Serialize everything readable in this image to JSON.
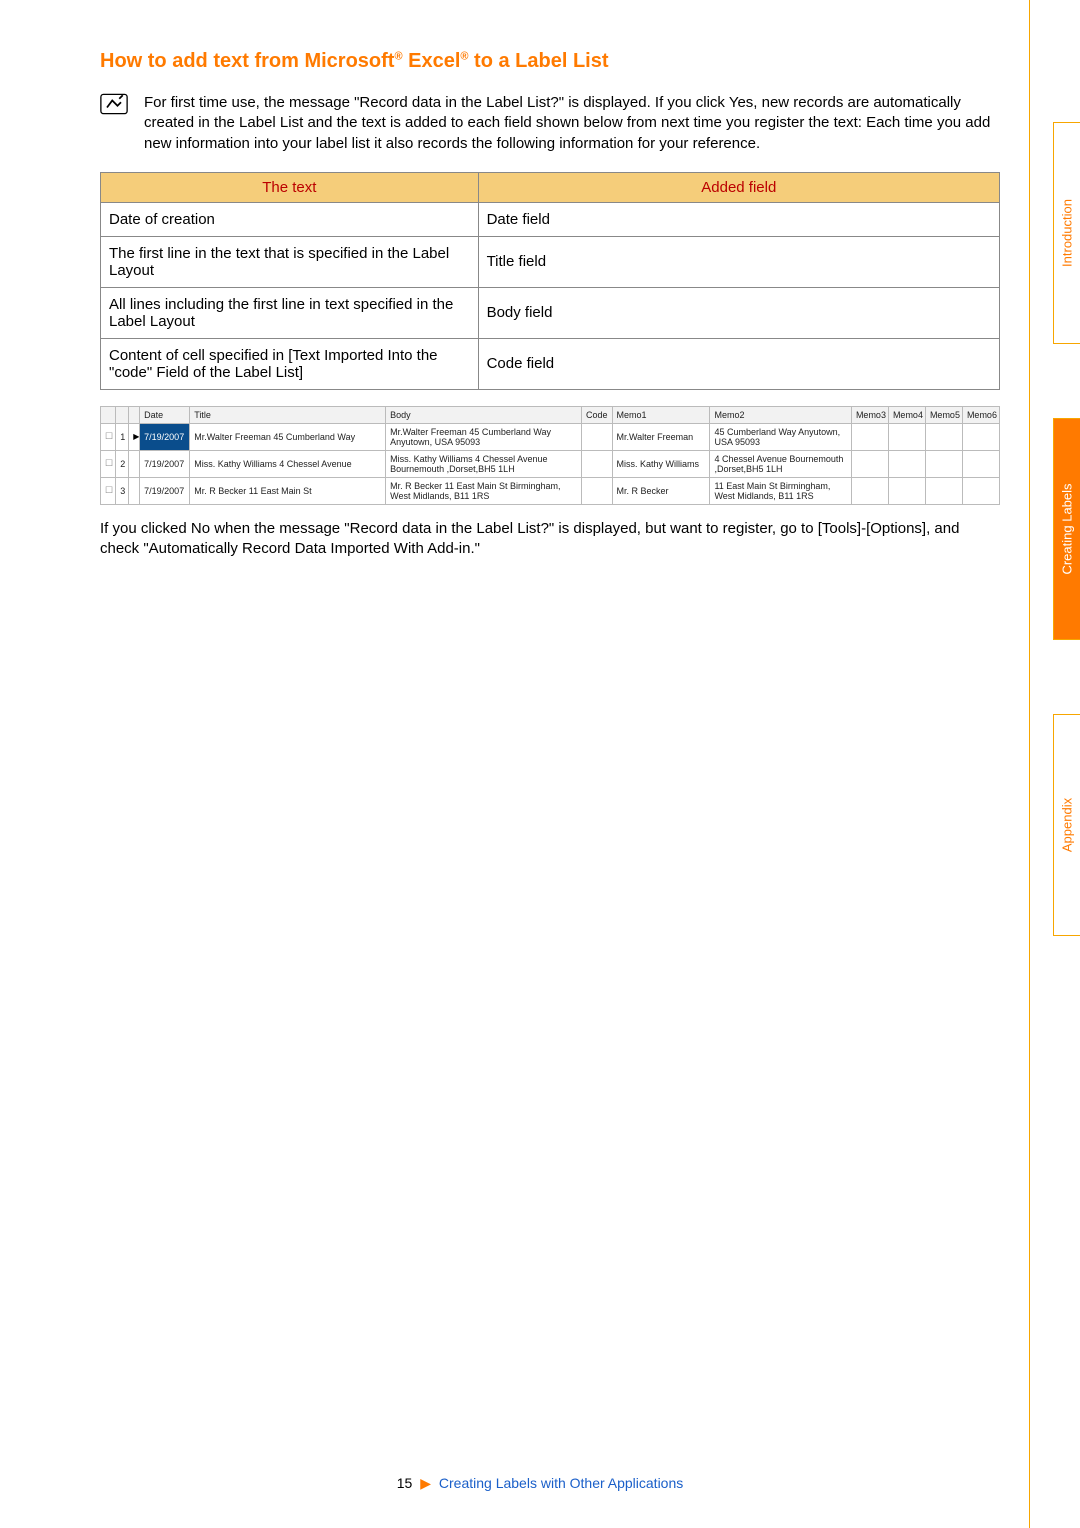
{
  "sideTabs": {
    "intro": {
      "label": "Introduction"
    },
    "create": {
      "label": "Creating Labels"
    },
    "appendix": {
      "label": "Appendix"
    }
  },
  "heading": {
    "pre": "How to add text from Microsoft",
    "mid": " Excel",
    "post": " to a Label List"
  },
  "note": "For first time use, the message \"Record data in the Label List?\" is displayed. If you click Yes, new records are automatically created in the Label List and the text is added to each field shown below from next time you register the text: Each time you add new information into your label list it also records the following information for your reference.",
  "fieldTable": {
    "headers": {
      "text": "The text",
      "added": "Added field"
    },
    "rows": [
      {
        "text": "Date of creation",
        "added": "Date field"
      },
      {
        "text": "The first line in the text that is specified in the Label Layout",
        "added": "Title field"
      },
      {
        "text": "All lines including the first line in text specified in the Label Layout",
        "added": "Body field"
      },
      {
        "text": "Content of cell specified in [Text Imported Into the \"code\" Field of the Label List]",
        "added": "Code field"
      }
    ]
  },
  "dataGrid": {
    "headers": [
      "",
      "",
      "",
      "Date",
      "Title",
      "Body",
      "Code",
      "Memo1",
      "Memo2",
      "Memo3",
      "Memo4",
      "Memo5",
      "Memo6"
    ],
    "rows": [
      {
        "num": "1",
        "sel": true,
        "date": "7/19/2007",
        "title": "Mr.Walter Freeman 45 Cumberland Way",
        "body": "Mr.Walter Freeman 45 Cumberland Way Anyutown, USA  95093",
        "code": "",
        "memo1": "Mr.Walter Freeman",
        "memo2": "45 Cumberland Way Anyutown, USA  95093"
      },
      {
        "num": "2",
        "sel": false,
        "date": "7/19/2007",
        "title": "Miss. Kathy Williams 4 Chessel Avenue",
        "body": "Miss. Kathy Williams 4 Chessel Avenue Bournemouth ,Dorset,BH5 1LH",
        "code": "",
        "memo1": "Miss. Kathy Williams",
        "memo2": "4 Chessel Avenue Bournemouth ,Dorset,BH5 1LH"
      },
      {
        "num": "3",
        "sel": false,
        "date": "7/19/2007",
        "title": "Mr. R Becker 11 East Main St",
        "body": "Mr. R Becker 11 East Main St Birmingham, West Midlands, B11 1RS",
        "code": "",
        "memo1": "Mr. R Becker",
        "memo2": "11 East Main St Birmingham, West Midlands, B11 1RS"
      }
    ]
  },
  "paragraph": "If you clicked No when the message \"Record data in the Label List?\" is displayed, but want to register, go to [Tools]-[Options], and check \"Automatically Record Data Imported With Add-in.\"",
  "footer": {
    "page": "15",
    "text": "Creating Labels with Other Applications"
  }
}
